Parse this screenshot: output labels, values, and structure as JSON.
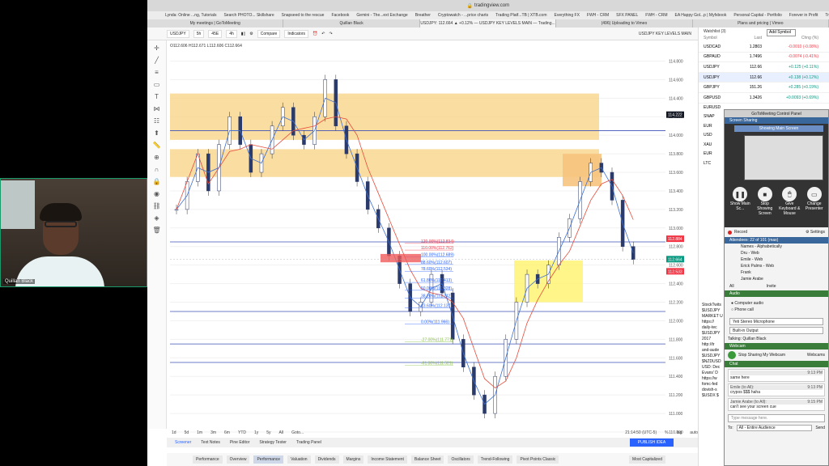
{
  "browser": {
    "url": "tradingview.com",
    "bookmarks": [
      "Lynda: Online ...ng, Tutorials",
      "Search PHOTO... Skillshare",
      "Snapseed to the rescue",
      "Facebook",
      "Gemini - The...ext Exchange",
      "Breather",
      "Cryptowatch - ...price charts",
      "Trading Platf...TB | XTB.com",
      "Everything FX",
      "FWH - CRM",
      "SFX PANEL",
      "FWH - CRM",
      "EA Happy Gol...p | Myfxbook",
      "Personal Capital - Portfolio",
      "Forever in Profit",
      "TradingView ...uotes online"
    ],
    "tabs": [
      {
        "label": "My meetings | GoToMeeting",
        "active": false
      },
      {
        "label": "Quillan Black",
        "active": false
      },
      {
        "label": "USDJPY: 112.664 ▲ +0.12% — USDJPY KEY LEVELS MAIN — Trading...",
        "active": true
      },
      {
        "label": "(496) Uploading to Vimeo",
        "active": false
      },
      {
        "label": "Plans and pricing | Vimeo",
        "active": false
      }
    ]
  },
  "toolbar": {
    "symbol": "USDJPY",
    "intervals": [
      "5h",
      "45E",
      "4h"
    ],
    "compare": "Compare",
    "indicators": "Indicators",
    "layout_title": "USDJPY KEY LEVELS MAIN"
  },
  "ohlc": "O112.606  H112.671  L112.606  C112.664",
  "chart_data": {
    "type": "candlestick",
    "symbol": "USDJPY",
    "price_ticks": [
      "114.800",
      "114.600",
      "114.400",
      "114.200",
      "114.000",
      "113.800",
      "113.600",
      "113.400",
      "113.200",
      "113.000",
      "112.800",
      "112.600",
      "112.400",
      "112.200",
      "112.000",
      "111.800",
      "111.600",
      "111.400",
      "111.200",
      "111.000",
      "110.800"
    ],
    "time_ticks": [
      "13:00",
      "23",
      "13:00",
      "28",
      "Nov",
      "6",
      "13:00",
      "13",
      "13:00",
      "20",
      "13:00",
      "27",
      "Dec",
      "8",
      "11",
      "13:00",
      "18",
      "13:00",
      "25"
    ],
    "last_price": "112.664",
    "marked_prices": [
      "114.222",
      "112.884",
      "112.664",
      "112.533"
    ],
    "fib_levels": [
      {
        "label": "120.00%(112.834)",
        "price": 112.834,
        "color": "#f23645"
      },
      {
        "label": "110.00%(112.762)",
        "price": 112.762,
        "color": "#f23645"
      },
      {
        "label": "100.00%(112.689)",
        "price": 112.689,
        "color": "#2962ff"
      },
      {
        "label": "88.60%(112.607)",
        "price": 112.607,
        "color": "#2962ff"
      },
      {
        "label": "78.60%(112.534)",
        "price": 112.534,
        "color": "#2962ff"
      },
      {
        "label": "61.80%(112.413)",
        "price": 112.413,
        "color": "#2962ff"
      },
      {
        "label": "50.00%(112.328)",
        "price": 112.328,
        "color": "#2962ff"
      },
      {
        "label": "38.20%(112.242)",
        "price": 112.242,
        "color": "#2962ff"
      },
      {
        "label": "23.60%(112.137)",
        "price": 112.137,
        "color": "#2962ff"
      },
      {
        "label": "0.00%(111.966)",
        "price": 111.966,
        "color": "#2962ff"
      },
      {
        "label": "-27.00%(111.771)",
        "price": 111.771,
        "color": "#8bc34a"
      },
      {
        "label": "-61.80%(111.521)",
        "price": 111.521,
        "color": "#8bc34a"
      }
    ],
    "zones": [
      {
        "from": 113.95,
        "to": 114.45,
        "color": "#f7d58a"
      },
      {
        "from": 113.55,
        "to": 113.85,
        "color": "#f7d58a"
      },
      {
        "from": 112.2,
        "to": 112.65,
        "color": "#fff26a"
      }
    ],
    "hlines": [
      114.05,
      112.85,
      112.1,
      111.75,
      111.55
    ],
    "ylim": [
      110.8,
      114.9
    ]
  },
  "bottom_timeframes": [
    "1d",
    "5d",
    "1m",
    "3m",
    "6m",
    "YTD",
    "1y",
    "5y",
    "All",
    "Goto..."
  ],
  "bottom_status": "21:14:50 (UTC-5)",
  "bottom_right": [
    "%",
    "log",
    "auto"
  ],
  "pane_tabs": [
    "Screener",
    "Text Notes",
    "Pine Editor",
    "Strategy Tester",
    "Trading Panel"
  ],
  "publish": "PUBLISH IDEA",
  "screener_tabs": [
    "Performance",
    "Overview",
    "Performance",
    "Valuation",
    "Dividends",
    "Margins",
    "Income Statement",
    "Balance Sheet",
    "Oscillators",
    "Trend-Following",
    "Pivot Points Classic"
  ],
  "screener_right": "Most Capitalized",
  "watchlist": {
    "title": "Watchlist (3)",
    "add_symbol": "Add Symbol",
    "cols": [
      "Symbol",
      "Last",
      "Chng (%)"
    ],
    "rows": [
      {
        "s": "USDCAD",
        "l": "1.2803",
        "c": "-0.0010 (-0.08%)",
        "neg": true
      },
      {
        "s": "GBPAUD",
        "l": "1.7496",
        "c": "-0.0074 (-0.41%)",
        "neg": true
      },
      {
        "s": "USDJPY",
        "l": "112.66",
        "c": "+0.125 (+0.11%)",
        "neg": false
      },
      {
        "s": "USDJPY",
        "l": "112.66",
        "c": "+0.138 (+0.12%)",
        "neg": false
      },
      {
        "s": "GBPJPY",
        "l": "151.26",
        "c": "+0.285 (+0.19%)",
        "neg": false
      },
      {
        "s": "GBPUSD",
        "l": "1.3426",
        "c": "+0.0093 (+0.69%)",
        "neg": false
      }
    ],
    "partial": [
      "EURUSD",
      "SNAP",
      "EUR",
      "USD",
      "XAU",
      "EUR",
      "LTC"
    ]
  },
  "stocktwits": [
    "StockTwits",
    "$USDJPY",
    "MARKET U",
    "https://",
    "daily-tec",
    "$USDJPY",
    "2017",
    "http://tr",
    "and-aude",
    "$USDJPY",
    "$NZDUSD",
    "USD: Dec",
    "Evans' D",
    "https://w",
    "fomc-fed",
    "dovish-s",
    "$USDX $"
  ],
  "gtm": {
    "title": "GoToMeeting Control Panel",
    "screen_sharing": "Screen Sharing",
    "showing": "Showing Main Screen",
    "buttons": [
      {
        "label": "Show Main Sc...",
        "icon": "❚❚"
      },
      {
        "label": "Stop Showing Screen",
        "icon": "■"
      },
      {
        "label": "Give Keyboard & Mouse",
        "icon": "🖱"
      },
      {
        "label": "Change Presenter",
        "icon": "▭"
      }
    ],
    "record": "Record",
    "settings": "Settings",
    "attendees_title": "Attendees: 22 of 101 (max)",
    "attendees": [
      "Names - Alphabetically",
      "Dru - Web",
      "Emile - Web",
      "Erick Palms - Web",
      "Frank",
      "Jamie Arabe"
    ],
    "all": "All",
    "invite": "Invite",
    "audio_title": "Audio",
    "audio_opts": [
      "Computer audio",
      "Phone call"
    ],
    "mic": "Yeti Stereo Microphone",
    "output": "Built-in Output",
    "talking": "Talking: Quillan Black",
    "webcam_title": "Webcam",
    "stop_sharing_webcam": "Stop Sharing My Webcam",
    "webcams": "Webcams",
    "chat_title": "Chat",
    "chat": [
      {
        "from": "",
        "time": "9:13 PM",
        "text": "same here"
      },
      {
        "from": "Emile (to All):",
        "time": "9:13 PM",
        "text": "crypos $$$ haha"
      },
      {
        "from": "Jamie Arabe (to All):",
        "time": "9:15 PM",
        "text": "can't see your screen cue"
      }
    ],
    "chat_placeholder": "Type message here.",
    "to": "To:",
    "audience": "All - Entire Audience",
    "send": "Send"
  },
  "webcam": {
    "name": "Quillan Black"
  }
}
